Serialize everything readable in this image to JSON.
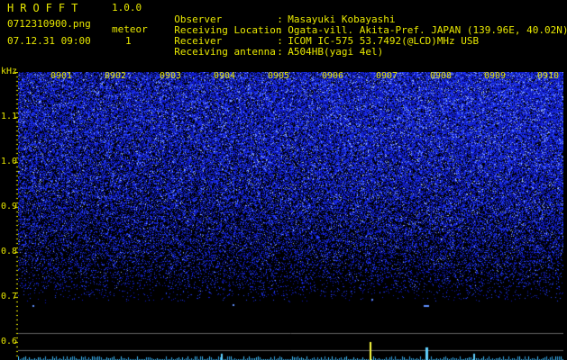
{
  "header": {
    "app_name": "HROFFT",
    "app_version": "1.0.0",
    "file_name": "0712310900.png",
    "timestamp": "07.12.31 09:00",
    "meteor_label": "meteor",
    "meteor_count": "1"
  },
  "info": [
    {
      "key": "Observer",
      "value": "Masayuki Kobayashi"
    },
    {
      "key": "Receiving Location",
      "value": "Ogata-vill. Akita-Pref. JAPAN (139.96E, 40.02N)"
    },
    {
      "key": "Receiver",
      "value": "ICOM IC-575 53.7492(@LCD)MHz USB"
    },
    {
      "key": "Receiving antenna",
      "value": "A504HB(yagi 4el)"
    }
  ],
  "axis": {
    "unit": "kHz",
    "freq_ticks": [
      "1.1",
      "1.0",
      "0.9",
      "0.8",
      "0.7",
      "0.6"
    ],
    "time_ticks": [
      "0901",
      "0902",
      "0903",
      "0904",
      "0905",
      "0906",
      "0907",
      "0908",
      "0909",
      "0910"
    ]
  },
  "colors": {
    "label": "#e8e800",
    "noise": "#2040ff",
    "noise_bright": "#a0c0ff",
    "meteor": "#ffff40",
    "baseline": "#40c0ff"
  }
}
